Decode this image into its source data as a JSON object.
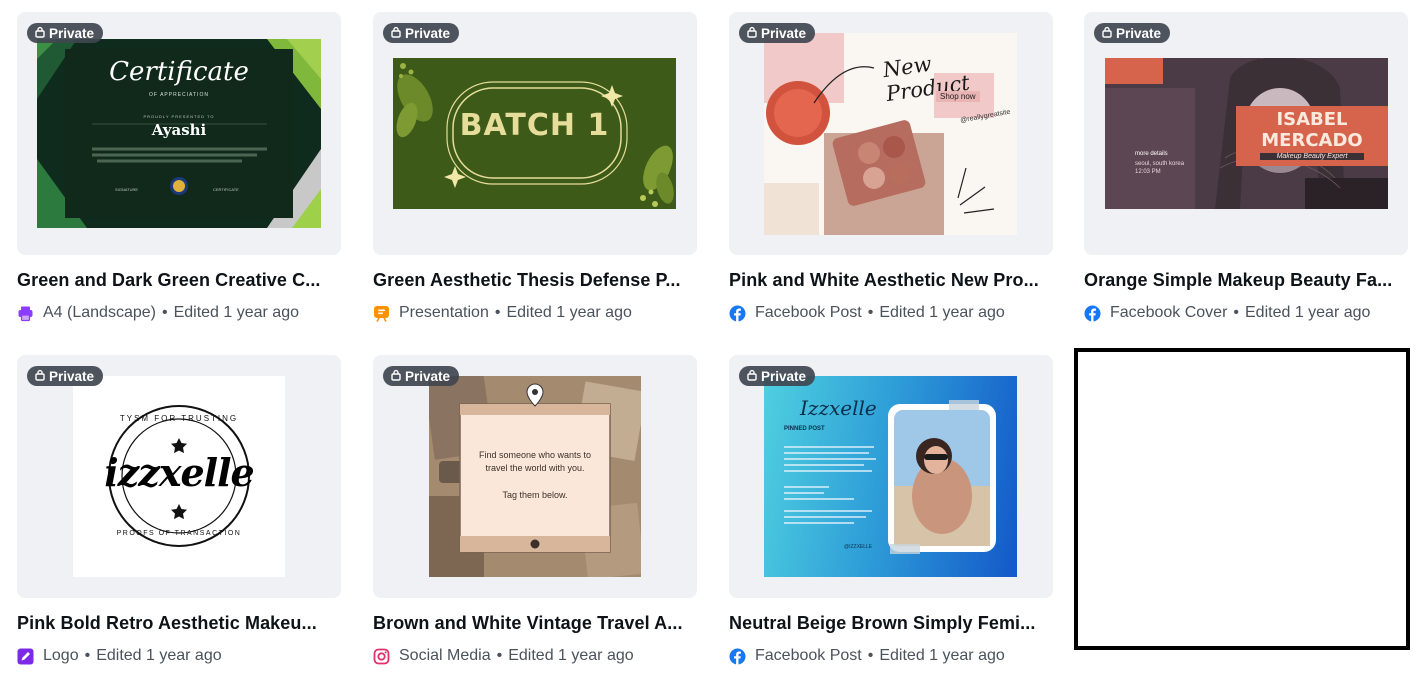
{
  "badge_label": "Private",
  "separator": "•",
  "cards": [
    {
      "title": "Green and Dark Green Creative C...",
      "type": "A4 (Landscape)",
      "edited": "Edited 1 year ago",
      "type_icon": "printer-icon",
      "type_color": "#8b3dff"
    },
    {
      "title": "Green Aesthetic Thesis Defense P...",
      "type": "Presentation",
      "edited": "Edited 1 year ago",
      "type_icon": "presentation-icon",
      "type_color": "#ff9100"
    },
    {
      "title": "Pink and White Aesthetic New Pro...",
      "type": "Facebook Post",
      "edited": "Edited 1 year ago",
      "type_icon": "facebook-icon",
      "type_color": "#1877f2"
    },
    {
      "title": "Orange Simple Makeup Beauty Fa...",
      "type": "Facebook Cover",
      "edited": "Edited 1 year ago",
      "type_icon": "facebook-icon",
      "type_color": "#1877f2"
    },
    {
      "title": "Pink Bold Retro Aesthetic Makeu...",
      "type": "Logo",
      "edited": "Edited 1 year ago",
      "type_icon": "pen-icon",
      "type_color": "#7d2ae8"
    },
    {
      "title": "Brown and White Vintage Travel A...",
      "type": "Social Media",
      "edited": "Edited 1 year ago",
      "type_icon": "instagram-icon",
      "type_color": "#e1306c"
    },
    {
      "title": "Neutral Beige Brown Simply Femi...",
      "type": "Facebook Post",
      "edited": "Edited 1 year ago",
      "type_icon": "facebook-icon",
      "type_color": "#1877f2"
    }
  ],
  "thumbs": {
    "certificate": {
      "heading": "Certificate",
      "sub": "OF APPRECIATION",
      "presented": "PROUDLY PRESENTED TO",
      "name": "Ayashi",
      "left_sig": "SIGNATURE",
      "right_sig": "CERTIFICATE"
    },
    "batch": {
      "text": "BATCH 1"
    },
    "new_product": {
      "script": "New Product",
      "shop": "Shop now",
      "handle": "@reallygreatsite"
    },
    "makeup": {
      "first": "ISABEL",
      "last": "MERCADO",
      "role": "Makeup Beauty Expert",
      "details": "more details",
      "location": "seoul, south korea",
      "time": "12:03 PM"
    },
    "logo": {
      "name": "izzxelle",
      "ring_top": "TYSM FOR TRUSTING",
      "ring_bottom": "PROOFS OF TRANSACTION"
    },
    "travel": {
      "line1": "Find someone who wants to",
      "line2": "travel the world with you.",
      "line3": "Tag them below."
    },
    "pinned": {
      "script": "Izzxelle",
      "heading": "PINNED POST",
      "handle": "@IZZXELLE"
    }
  }
}
